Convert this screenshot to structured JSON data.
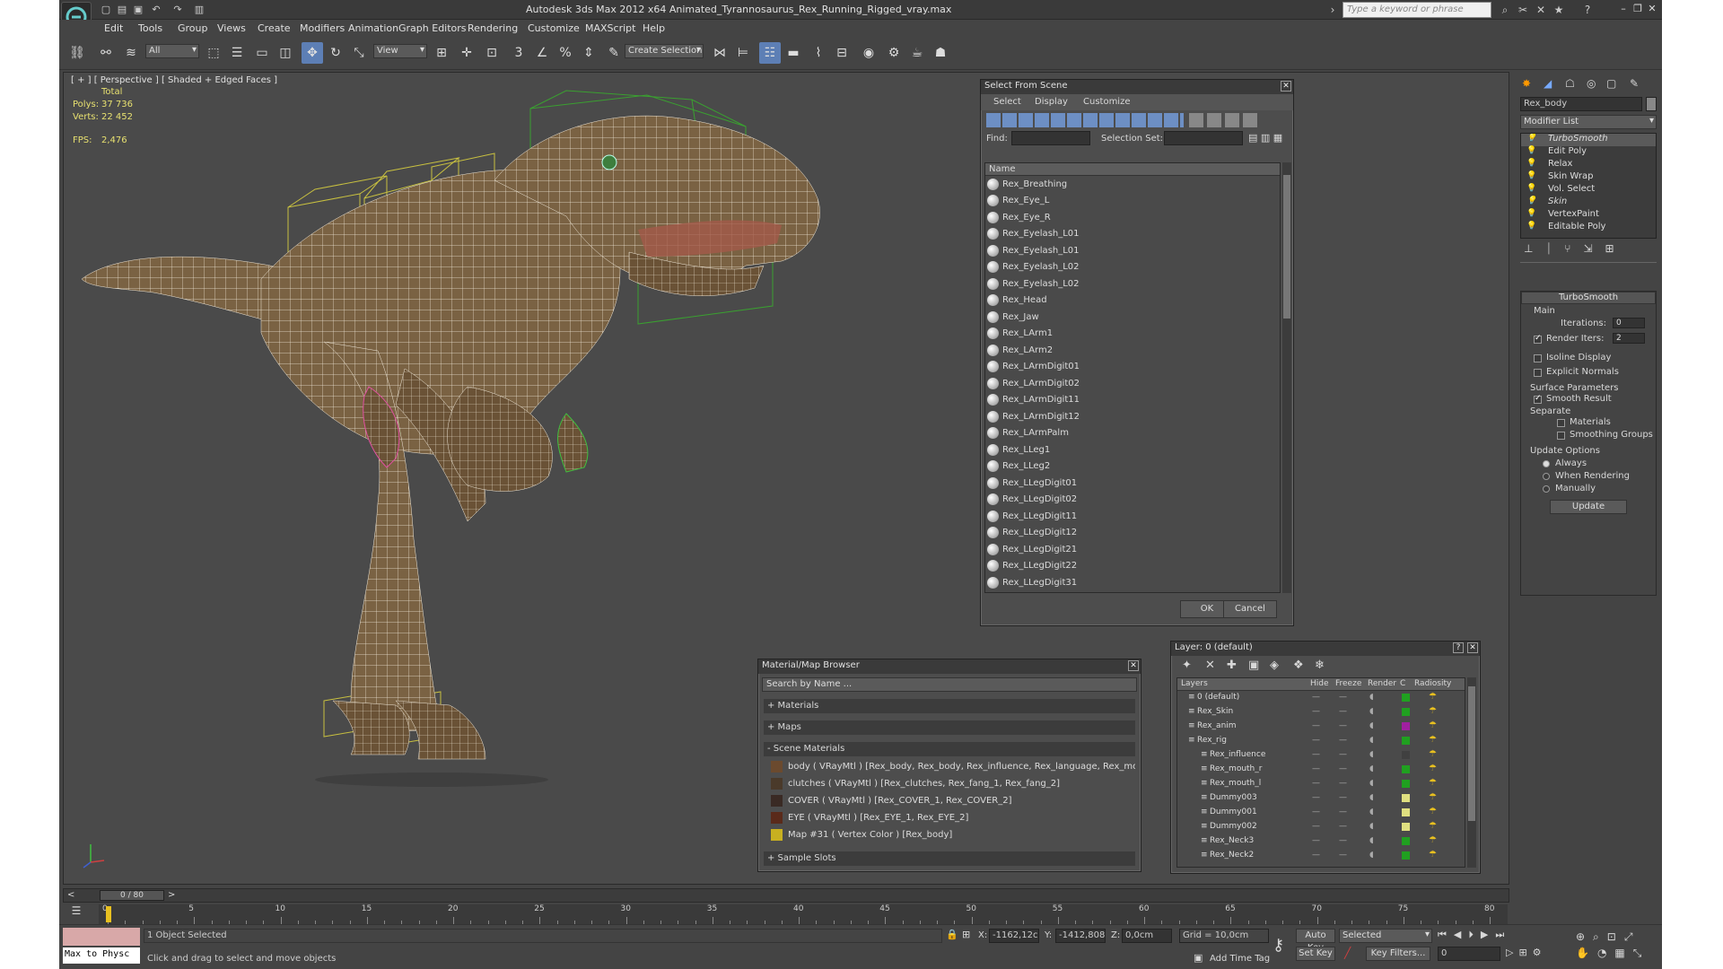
{
  "window": {
    "title": "Autodesk 3ds Max  2012 x64      Animated_Tyrannosaurus_Rex_Running_Rigged_vray.max",
    "search_placeholder": "Type a keyword or phrase"
  },
  "menu": [
    "Edit",
    "Tools",
    "Group",
    "Views",
    "Create",
    "Modifiers",
    "Animation",
    "Graph Editors",
    "Rendering",
    "Customize",
    "MAXScript",
    "Help"
  ],
  "toolbar": {
    "selection_filter": "All",
    "ref_coord": "View",
    "selection_set": "Create Selection Se"
  },
  "viewport": {
    "label": "[ + ] [ Perspective ] [ Shaded + Edged Faces ]",
    "stats_header": "Total",
    "polys_label": "Polys:",
    "polys": "37 736",
    "verts_label": "Verts:",
    "verts": "22 452",
    "fps_label": "FPS:",
    "fps": "2,476"
  },
  "select_scene": {
    "title": "Select From Scene",
    "menu": [
      "Select",
      "Display",
      "Customize"
    ],
    "find_label": "Find:",
    "selection_set_label": "Selection Set:",
    "column": "Name",
    "items": [
      "Rex_Breathing",
      "Rex_Eye_L",
      "Rex_Eye_R",
      "Rex_Eyelash_L01",
      "Rex_Eyelash_L01",
      "Rex_Eyelash_L02",
      "Rex_Eyelash_L02",
      "Rex_Head",
      "Rex_Jaw",
      "Rex_LArm1",
      "Rex_LArm2",
      "Rex_LArmDigit01",
      "Rex_LArmDigit02",
      "Rex_LArmDigit11",
      "Rex_LArmDigit12",
      "Rex_LArmPalm",
      "Rex_LLeg1",
      "Rex_LLeg2",
      "Rex_LLegDigit01",
      "Rex_LLegDigit02",
      "Rex_LLegDigit11",
      "Rex_LLegDigit12",
      "Rex_LLegDigit21",
      "Rex_LLegDigit22",
      "Rex_LLegDigit31"
    ],
    "ok": "OK",
    "cancel": "Cancel"
  },
  "material_browser": {
    "title": "Material/Map Browser",
    "search": "Search by Name ...",
    "sections": {
      "materials": "+ Materials",
      "maps": "+ Maps",
      "scene": "- Scene Materials",
      "slots": "+ Sample Slots"
    },
    "items": [
      {
        "text": "body  ( VRayMtl )  [Rex_body, Rex_body, Rex_influence, Rex_language, Rex_mo...",
        "color": "#6b4a2e"
      },
      {
        "text": "clutches  ( VRayMtl )  [Rex_clutches, Rex_fang_1, Rex_fang_2]",
        "color": "#4a3a2a"
      },
      {
        "text": "COVER  ( VRayMtl )  [Rex_COVER_1, Rex_COVER_2]",
        "color": "#3a2a24"
      },
      {
        "text": "EYE  ( VRayMtl )  [Rex_EYE_1, Rex_EYE_2]",
        "color": "#5a2a1a"
      },
      {
        "text": "Map #31  ( Vertex Color )  [Rex_body]",
        "color": "#c8b020"
      }
    ]
  },
  "layers": {
    "title": "Layer: 0 (default)",
    "columns": [
      "Layers",
      "Hide",
      "Freeze",
      "Render",
      "C",
      "Radiosity"
    ],
    "rows": [
      {
        "name": "0 (default)",
        "color": "#20a020"
      },
      {
        "name": "Rex_Skin",
        "color": "#20a020"
      },
      {
        "name": "Rex_anim",
        "color": "#a020a0"
      },
      {
        "name": "Rex_rig",
        "color": "#20a020"
      },
      {
        "name": "Rex_influence",
        "color": "#404040"
      },
      {
        "name": "Rex_mouth_r",
        "color": "#20a020"
      },
      {
        "name": "Rex_mouth_l",
        "color": "#20a020"
      },
      {
        "name": "Dummy003",
        "color": "#e0e080"
      },
      {
        "name": "Dummy001",
        "color": "#e0e080"
      },
      {
        "name": "Dummy002",
        "color": "#e0e080"
      },
      {
        "name": "Rex_Neck3",
        "color": "#20a020"
      },
      {
        "name": "Rex_Neck2",
        "color": "#20a020"
      }
    ]
  },
  "command_panel": {
    "object_name": "Rex_body",
    "modifier_list": "Modifier List",
    "stack": [
      "TurboSmooth",
      "Edit Poly",
      "Relax",
      "Skin Wrap",
      "Vol. Select",
      "Skin",
      "VertexPaint",
      "Editable Poly"
    ],
    "rollout": "TurboSmooth",
    "main": "Main",
    "iterations_label": "Iterations:",
    "iterations": "0",
    "render_iters_label": "Render Iters:",
    "render_iters": "2",
    "isoline": "Isoline Display",
    "explicit": "Explicit Normals",
    "surface": "Surface Parameters",
    "smooth_result": "Smooth Result",
    "separate": "Separate",
    "materials": "Materials",
    "smoothing": "Smoothing Groups",
    "update_options": "Update Options",
    "always": "Always",
    "when_rendering": "When Rendering",
    "manually": "Manually",
    "update": "Update"
  },
  "timeline": {
    "frame": "0 / 80",
    "ticks": [
      "0",
      "5",
      "10",
      "15",
      "20",
      "25",
      "30",
      "35",
      "40",
      "45",
      "50",
      "55",
      "60",
      "65",
      "70",
      "75",
      "80"
    ]
  },
  "status": {
    "maxscript": "Max to Physc",
    "selected": "1 Object Selected",
    "prompt": "Click and drag to select and move objects",
    "x_label": "X:",
    "x": "-1162,12c",
    "y_label": "Y:",
    "y": "-1412,808",
    "z_label": "Z:",
    "z": "0,0cm",
    "grid": "Grid = 10,0cm",
    "add_time_tag": "Add Time Tag",
    "auto_key": "Auto Key",
    "set_key": "Set Key",
    "key_mode": "Selected",
    "key_filters": "Key Filters...",
    "frame": "0"
  }
}
